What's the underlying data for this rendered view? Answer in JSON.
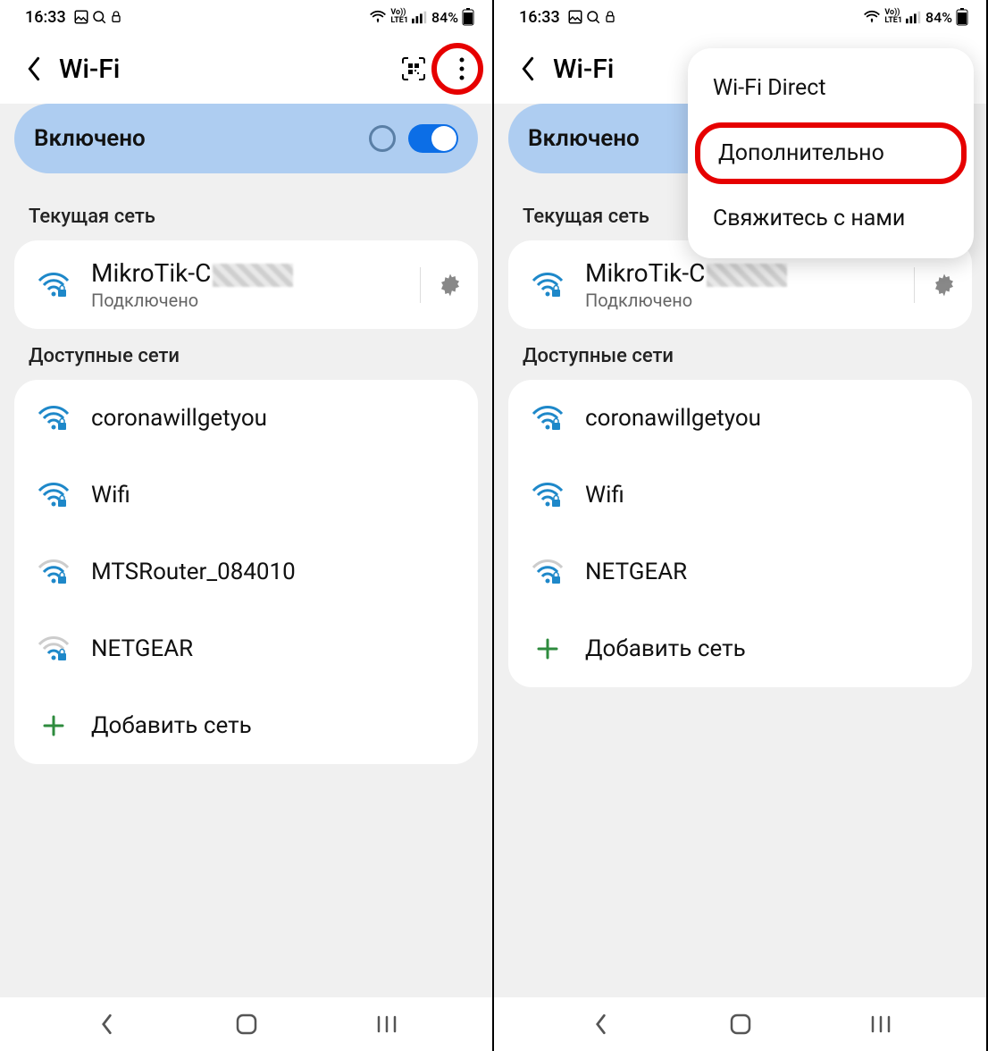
{
  "status": {
    "time": "16:33",
    "battery_text": "84%"
  },
  "appbar": {
    "title": "Wi-Fi"
  },
  "toggle": {
    "label": "Включено"
  },
  "sections": {
    "current": "Текущая сеть",
    "available": "Доступные сети"
  },
  "current_network": {
    "name_prefix": "MikroTik-C",
    "status": "Подключено"
  },
  "left_networks": [
    "coronawillgetyou",
    "Wifi",
    "MTSRouter_084010",
    "NETGEAR"
  ],
  "right_networks": [
    "coronawillgetyou",
    "Wifi",
    "NETGEAR"
  ],
  "add_network": "Добавить сеть",
  "popup": {
    "item1": "Wi-Fi Direct",
    "item2": "Дополнительно",
    "item3": "Свяжитесь с нами"
  }
}
